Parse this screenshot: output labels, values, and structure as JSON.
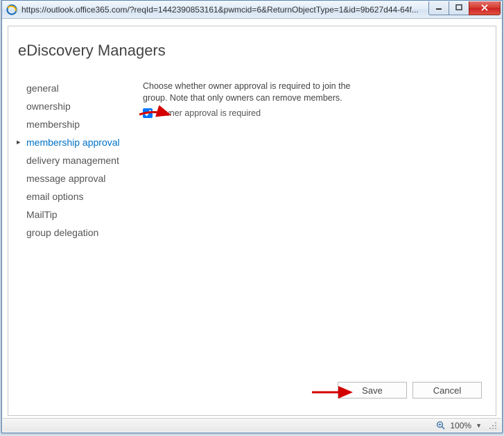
{
  "window": {
    "url": "https://outlook.office365.com/?reqId=1442390853161&pwmcid=6&ReturnObjectType=1&id=9b627d44-64f..."
  },
  "page": {
    "title": "eDiscovery Managers"
  },
  "sidebar": {
    "items": [
      {
        "label": "general"
      },
      {
        "label": "ownership"
      },
      {
        "label": "membership"
      },
      {
        "label": "membership approval",
        "active": true
      },
      {
        "label": "delivery management"
      },
      {
        "label": "message approval"
      },
      {
        "label": "email options"
      },
      {
        "label": "MailTip"
      },
      {
        "label": "group delegation"
      }
    ]
  },
  "main": {
    "description": "Choose whether owner approval is required to join the group. Note that only owners can remove members.",
    "checkbox_label": "Owner approval is required",
    "checkbox_checked": true
  },
  "footer": {
    "save_label": "Save",
    "cancel_label": "Cancel"
  },
  "statusbar": {
    "zoom": "100%"
  }
}
